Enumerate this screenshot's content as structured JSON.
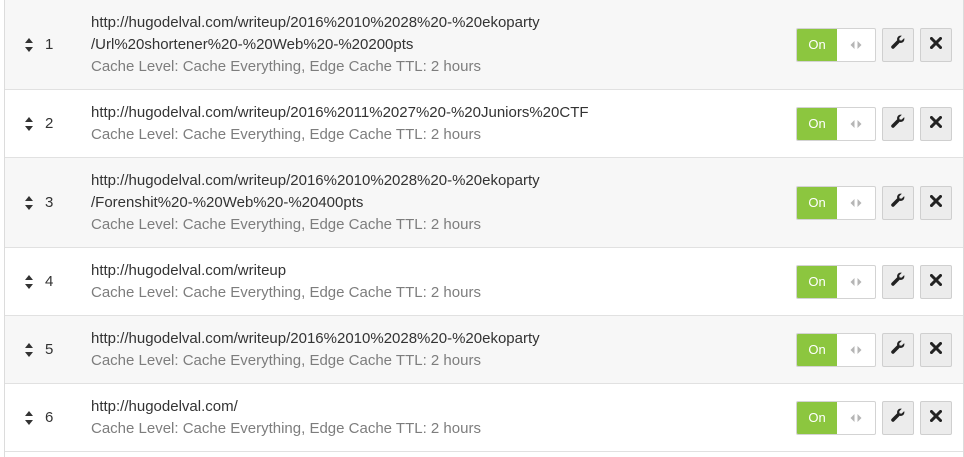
{
  "toggle_label": "On",
  "accent_color": "#8cc63f",
  "rules": [
    {
      "index": "1",
      "url_lines": [
        "http://hugodelval.com/writeup/2016%2010%2028%20-%20ekoparty",
        "/Url%20shortener%20-%20Web%20-%20200pts"
      ],
      "settings": "Cache Level: Cache Everything, Edge Cache TTL: 2 hours"
    },
    {
      "index": "2",
      "url_lines": [
        "http://hugodelval.com/writeup/2016%2011%2027%20-%20Juniors%20CTF"
      ],
      "settings": "Cache Level: Cache Everything, Edge Cache TTL: 2 hours"
    },
    {
      "index": "3",
      "url_lines": [
        "http://hugodelval.com/writeup/2016%2010%2028%20-%20ekoparty",
        "/Forenshit%20-%20Web%20-%20400pts"
      ],
      "settings": "Cache Level: Cache Everything, Edge Cache TTL: 2 hours"
    },
    {
      "index": "4",
      "url_lines": [
        "http://hugodelval.com/writeup"
      ],
      "settings": "Cache Level: Cache Everything, Edge Cache TTL: 2 hours"
    },
    {
      "index": "5",
      "url_lines": [
        "http://hugodelval.com/writeup/2016%2010%2028%20-%20ekoparty"
      ],
      "settings": "Cache Level: Cache Everything, Edge Cache TTL: 2 hours"
    },
    {
      "index": "6",
      "url_lines": [
        "http://hugodelval.com/"
      ],
      "settings": "Cache Level: Cache Everything, Edge Cache TTL: 2 hours"
    }
  ],
  "icons": {
    "drag": "drag-handle-icon",
    "grip": "toggle-grip-icon",
    "edit": "wrench-icon",
    "delete": "close-icon"
  }
}
